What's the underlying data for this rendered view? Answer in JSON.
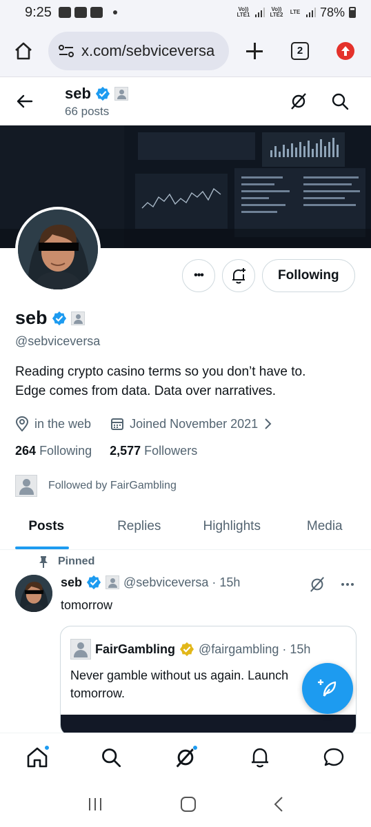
{
  "status_bar": {
    "time": "9:25",
    "carrier1": "Vo)) LTE1",
    "carrier2": "Vo)) LTE2",
    "net": "LTE",
    "battery": "78%"
  },
  "browser": {
    "url": "x.com/sebviceversa",
    "tab_count": "2"
  },
  "profile_header": {
    "name": "seb",
    "posts": "66 posts"
  },
  "profile": {
    "name": "seb",
    "handle": "@sebviceversa",
    "bio_line1": "Reading crypto casino terms so you don’t have to.",
    "bio_line2": "Edge comes from data. Data over narratives.",
    "location": "in the web",
    "joined": "Joined November 2021",
    "following_count": "264",
    "following_label": "Following",
    "followers_count": "2,577",
    "followers_label": "Followers",
    "followed_by": "Followed by FairGambling",
    "follow_button": "Following",
    "more_label": "•••"
  },
  "tabs": [
    "Posts",
    "Replies",
    "Highlights",
    "Media"
  ],
  "post": {
    "pinned": "Pinned",
    "author": "seb",
    "handle": "@sebviceversa · 15h",
    "text": "tomorrow",
    "quote": {
      "author": "FairGambling",
      "handle": "@fairgambling · 15h",
      "text": "Never gamble without us again. Launch tomorrow."
    }
  },
  "icons": {
    "home": "home-icon",
    "search": "search-icon",
    "grok": "grok-icon",
    "notifications": "bell-icon",
    "messages": "messages-icon"
  },
  "colors": {
    "accent": "#1d9bf0",
    "verified": "#1d9bf0",
    "gold": "#e2b719",
    "text": "#0f1419",
    "muted": "#536471"
  }
}
